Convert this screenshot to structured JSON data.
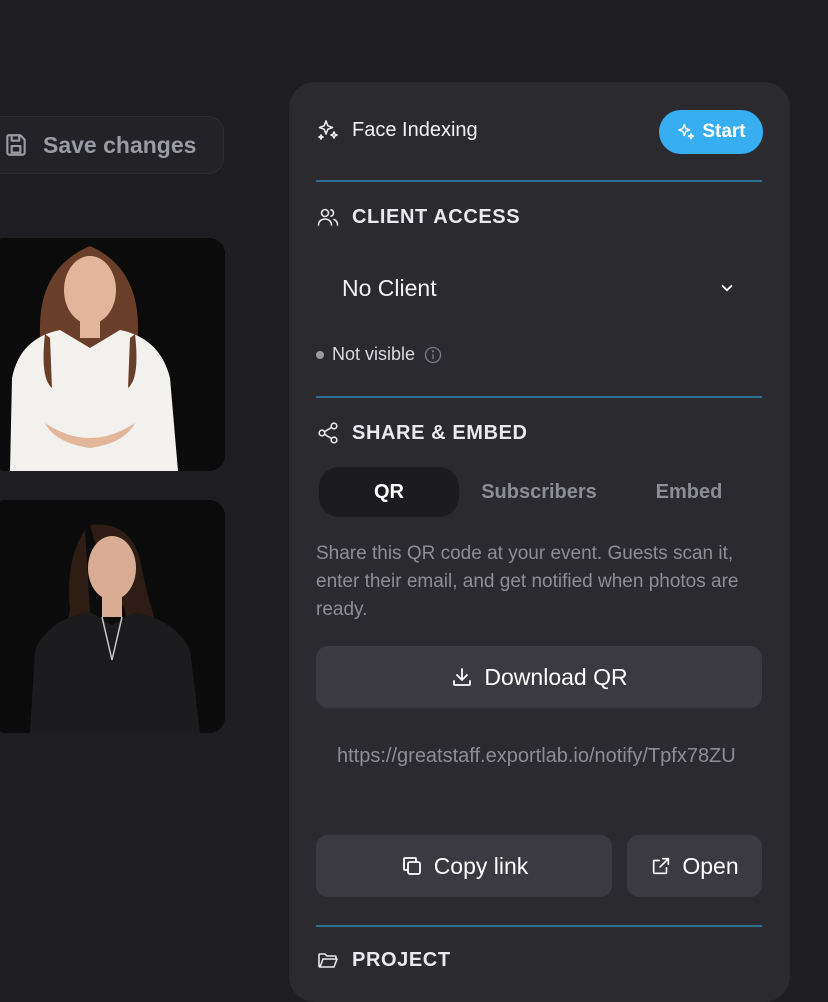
{
  "left": {
    "save_label": "Save changes"
  },
  "face_indexing": {
    "title": "Face Indexing",
    "start_label": "Start"
  },
  "client_access": {
    "title": "CLIENT ACCESS",
    "selected_client": "No Client",
    "visibility": "Not visible"
  },
  "share": {
    "title": "SHARE & EMBED",
    "tabs": [
      {
        "label": "QR",
        "active": true
      },
      {
        "label": "Subscribers",
        "active": false
      },
      {
        "label": "Embed",
        "active": false
      }
    ],
    "description": "Share this QR code at your event. Guests scan it, enter their email, and get notified when photos are ready.",
    "download_label": "Download QR",
    "url": "https://greatstaff.exportlab.io/notify/Tpfx78ZU",
    "copy_label": "Copy link",
    "open_label": "Open"
  },
  "project": {
    "title": "PROJECT"
  },
  "colors": {
    "background": "#1e1e22",
    "panel": "#2a2a2f",
    "accent": "#38aef2",
    "divider": "#2f6f8f"
  }
}
